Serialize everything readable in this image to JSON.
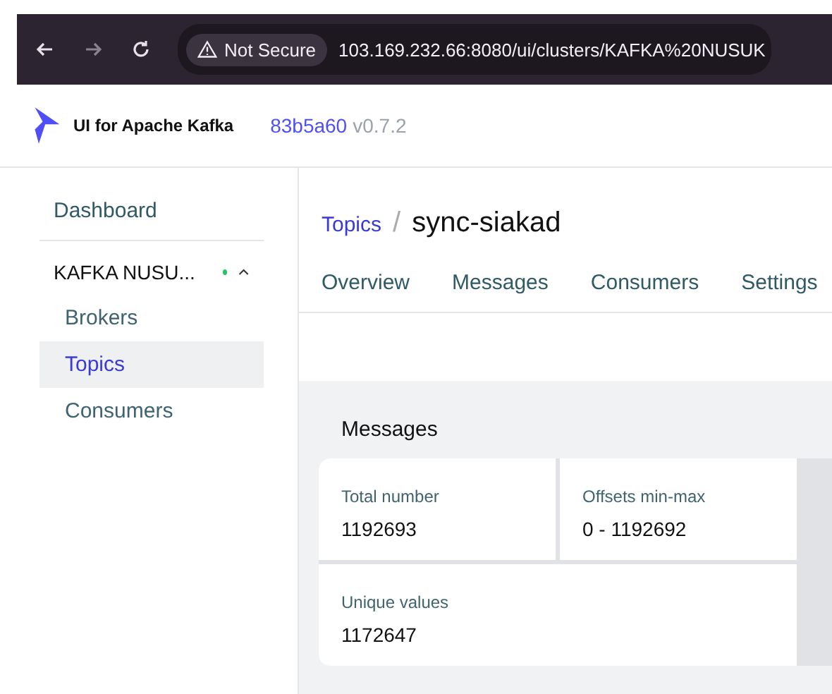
{
  "browser": {
    "security": "Not Secure",
    "url": "103.169.232.66:8080/ui/clusters/KAFKA%20NUSUK"
  },
  "header": {
    "app_name": "UI for Apache Kafka",
    "commit": "83b5a60",
    "version": "v0.7.2"
  },
  "sidebar": {
    "dashboard": "Dashboard",
    "cluster": {
      "name": "KAFKA NUSU...",
      "color": "#22c55e",
      "expanded": true
    },
    "items": [
      {
        "label": "Brokers",
        "selected": false
      },
      {
        "label": "Topics",
        "selected": true
      },
      {
        "label": "Consumers",
        "selected": false
      }
    ]
  },
  "breadcrumb": {
    "parent": "Topics",
    "separator": "/",
    "current": "sync-siakad"
  },
  "tabs": [
    {
      "label": "Overview"
    },
    {
      "label": "Messages"
    },
    {
      "label": "Consumers"
    },
    {
      "label": "Settings"
    }
  ],
  "messages": {
    "title": "Messages",
    "stats": [
      {
        "label": "Total number",
        "value": "1192693"
      },
      {
        "label": "Offsets min-max",
        "value": "0 - 1192692"
      },
      {
        "label": "Unique values",
        "value": "1172647"
      }
    ]
  }
}
